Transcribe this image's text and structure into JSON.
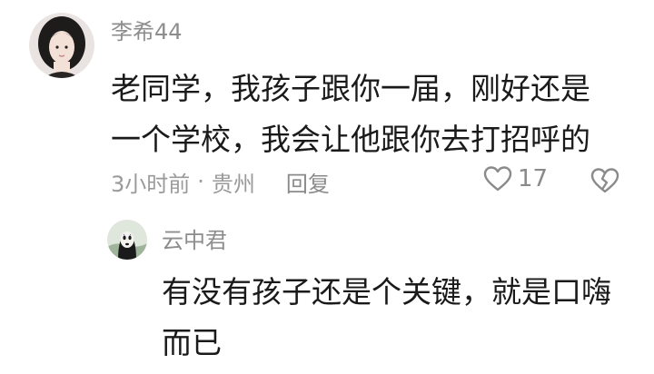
{
  "comment": {
    "username": "李希44",
    "text_line1": "老同学，我孩子跟你一届，刚好还是",
    "text_line2": "一个学校，我会让他跟你去打招呼的",
    "time": "3小时前",
    "separator": "·",
    "location": "贵州",
    "reply_label": "回复",
    "like_count": "17"
  },
  "reply": {
    "username": "云中君",
    "text_line1": "有没有孩子还是个关键，就是口嗨",
    "text_line2": "而已"
  },
  "icons": {
    "like": "heart-outline-icon",
    "dislike": "broken-heart-icon"
  },
  "colors": {
    "username": "#8d8d8d",
    "text": "#1a1a1a",
    "meta": "#9a9a9a"
  }
}
